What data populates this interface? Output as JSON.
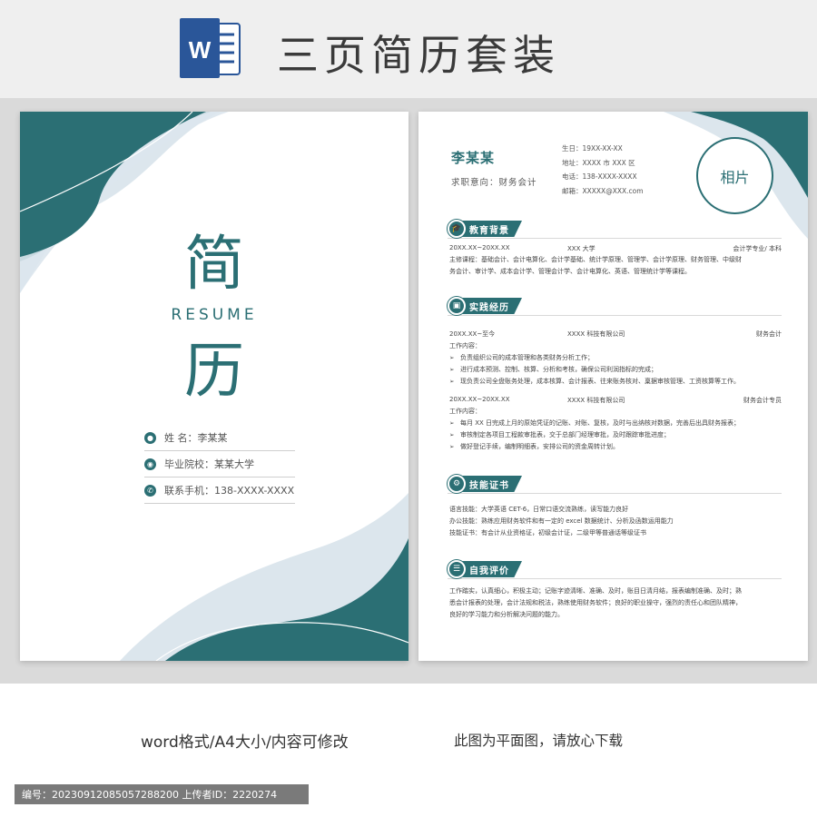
{
  "header": {
    "title": "三页简历套装",
    "app_icon": "word-icon",
    "app_icon_letter": "W"
  },
  "cover": {
    "title_char_1": "简",
    "title_char_2": "历",
    "subtitle": "RESUME",
    "info": [
      {
        "icon": "person-icon",
        "text": "姓      名：李某某"
      },
      {
        "icon": "location-icon",
        "text": "毕业院校：某某大学"
      },
      {
        "icon": "phone-icon",
        "text": "联系手机：138-XXXX-XXXX"
      }
    ]
  },
  "resume": {
    "name": "李某某",
    "intent": "求职意向：财务会计",
    "contact": [
      "生日：19XX-XX-XX",
      "地址：XXXX 市 XXX 区",
      "电话：138-XXXX-XXXX",
      "邮箱：XXXXX@XXX.com"
    ],
    "photo_label": "相片",
    "sections": {
      "education": {
        "title": "教育背景",
        "row": [
          "20XX.XX~20XX.XX",
          "XXX 大学",
          "会计学专业/ 本科"
        ],
        "lines": [
          "主修课程：基础会计、会计电算化、会计学基础、统计学原理、管理学、会计学原理、财务管理、中级财",
          "务会计、审计学、成本会计学、管理会计学、会计电算化、英语、管理统计学等课程。"
        ]
      },
      "practice": {
        "title": "实践经历",
        "job1_row": [
          "20XX.XX~至今",
          "XXXX 科技有限公司",
          "财务会计"
        ],
        "job1_label": "工作内容：",
        "job1_bullets": [
          "负责组织公司的成本管理和各类财务分析工作；",
          "进行成本预测、控制、核算、分析和考核，确保公司利润指标的完成；",
          "现负责公司全盘账务处理，成本核算、会计报表、往来账务核对、稟据审核管理、工资核算等工作。"
        ],
        "job2_row": [
          "20XX.XX~20XX.XX",
          "XXXX 科技有限公司",
          "财务会计专员"
        ],
        "job2_label": "工作内容：",
        "job2_bullets": [
          "每月 XX 日完成上月的原始凭证的记账、对账、复核，及时与出纳核对数据，完善后出具财务报表；",
          "审核制定各项目工程款审批表，交于总部门经理审批，及时跟踪审批进度；",
          "做好登记手续，编制明细表，安排公司的资金周转计划。"
        ]
      },
      "skills": {
        "title": "技能证书",
        "lines": [
          "语言技能：大学英语 CET-6，日常口语交流熟练，读写能力良好",
          "办公技能：熟练应用财务软件和有一定的 excel 数据统计、分析及函数运用能力",
          "技能证书：有会计从业资格证，初级会计证，二级甲等普通话等级证书"
        ]
      },
      "self": {
        "title": "自我评价",
        "lines": [
          "工作踏实，认真细心，积极主动；记账字迹清晰、准确、及时，账目日清月结，报表编制准确、及时；熟",
          "悉会计报表的处理，会计法规和税法，熟练使用财务软件；良好的职业操守，强烈的责任心和团队精神，",
          "良好的学习能力和分析解决问题的能力。"
        ]
      }
    }
  },
  "footer": {
    "left": "word格式/A4大小/内容可修改",
    "right": "此图为平面图，请放心下载",
    "meta": "编号：20230912085057288200   上传者ID：2220274"
  },
  "colors": {
    "accent": "#2b6f74",
    "pale": "#dce6ed",
    "header_bg": "#efefef",
    "word_blue": "#2a5699"
  }
}
